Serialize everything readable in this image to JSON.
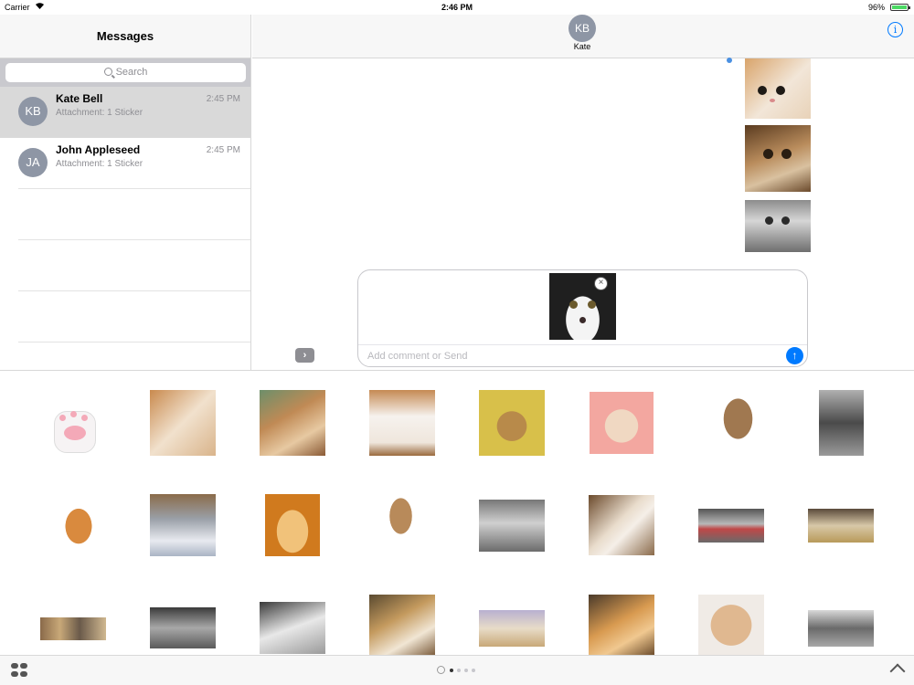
{
  "status_bar": {
    "carrier": "Carrier",
    "time": "2:46 PM",
    "battery": "96%"
  },
  "sidebar": {
    "title": "Messages",
    "search_placeholder": "Search",
    "conversations": [
      {
        "initials": "KB",
        "name": "Kate Bell",
        "preview": "Attachment: 1 Sticker",
        "time": "2:45 PM",
        "selected": true
      },
      {
        "initials": "JA",
        "name": "John Appleseed",
        "preview": "Attachment: 1 Sticker",
        "time": "2:45 PM",
        "selected": false
      }
    ]
  },
  "conversation": {
    "initials": "KB",
    "name": "Kate"
  },
  "compose": {
    "placeholder": "Add comment or Send",
    "send_icon": "↑",
    "remove_icon": "×",
    "expand_icon": "›"
  },
  "drawer": {
    "page_count": 4,
    "current_page": 1
  },
  "colors": {
    "accent": "#007aff",
    "avatar": "#8e96a5",
    "selected_row": "#d9d9d9"
  },
  "icons": [
    "wifi-icon",
    "battery-icon",
    "search-icon",
    "info-icon",
    "send-icon",
    "remove-icon",
    "apps-icon",
    "chevron-up-icon"
  ]
}
